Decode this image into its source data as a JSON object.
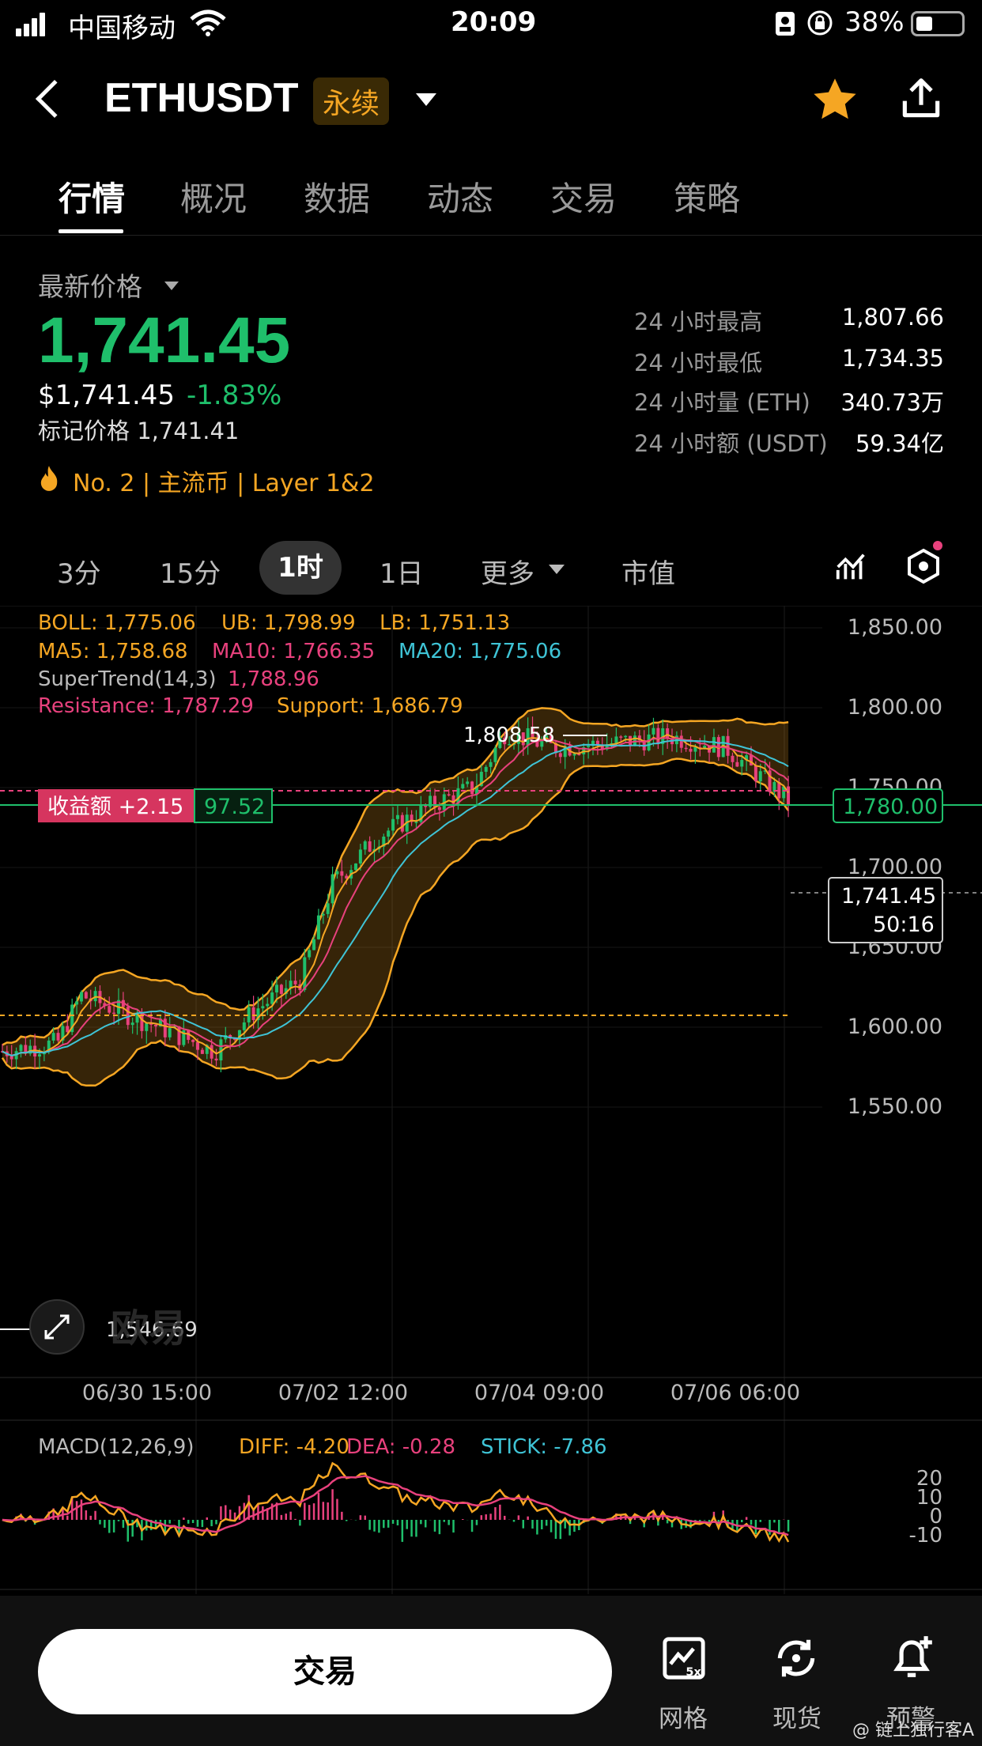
{
  "status": {
    "carrier": "中国移动",
    "time": "20:09",
    "battery": "38%"
  },
  "nav": {
    "symbol": "ETHUSDT",
    "perp_tag": "永续"
  },
  "tabs": [
    "行情",
    "概况",
    "数据",
    "动态",
    "交易",
    "策略"
  ],
  "price": {
    "label": "最新价格",
    "last": "1,741.45",
    "usd": "$1,741.45",
    "change": "-1.83%",
    "mark": "标记价格 1,741.41",
    "tags": "No. 2  |  主流币  |  Layer 1&2"
  },
  "stats": [
    {
      "label": "24 小时最高",
      "value": "1,807.66"
    },
    {
      "label": "24 小时最低",
      "value": "1,734.35"
    },
    {
      "label": "24 小时量 (ETH)",
      "value": "340.73万"
    },
    {
      "label": "24 小时额 (USDT)",
      "value": "59.34亿"
    }
  ],
  "intervals": [
    "3分",
    "15分",
    "1时",
    "1日",
    "更多",
    "市值"
  ],
  "indicators": {
    "boll": "BOLL: 1,775.06",
    "ub": "UB: 1,798.99",
    "lb": "LB: 1,751.13",
    "ma5": "MA5: 1,758.68",
    "ma10": "MA10: 1,766.35",
    "ma20": "MA20: 1,775.06",
    "super": "SuperTrend(14,3)",
    "super_val": "1,788.96",
    "res": "Resistance: 1,787.29",
    "sup": "Support: 1,686.79",
    "high_mark": "1,808.58",
    "low_mark": "1,546.69",
    "pnl_label": "收益额 +2.15",
    "pnl_val": "97.52",
    "order_price": "1,780.00",
    "cur_price": "1,741.45",
    "countdown": "50:16",
    "watermark": "欧易"
  },
  "y_axis": [
    "1,850.00",
    "1,800.00",
    "1,750.00",
    "1,700.00",
    "1,650.00",
    "1,600.00",
    "1,550.00"
  ],
  "x_axis": [
    "06/30 15:00",
    "07/02 12:00",
    "07/04 09:00",
    "07/06 06:00"
  ],
  "macd": {
    "label": "MACD(12,26,9)",
    "diff": "DIFF: -4.20",
    "dea": "DEA: -0.28",
    "stick": "STICK: -7.86",
    "axis": [
      "20",
      "10",
      "0",
      "-10"
    ]
  },
  "bottom": {
    "trade": "交易",
    "grid": "网格",
    "spot": "现货",
    "alert": "预警",
    "watermark": "@ 链上独行客A"
  },
  "colors": {
    "up": "#1fbf6b",
    "down": "#e8417d",
    "accent": "#f5a623",
    "ma20": "#3fc4d6"
  }
}
